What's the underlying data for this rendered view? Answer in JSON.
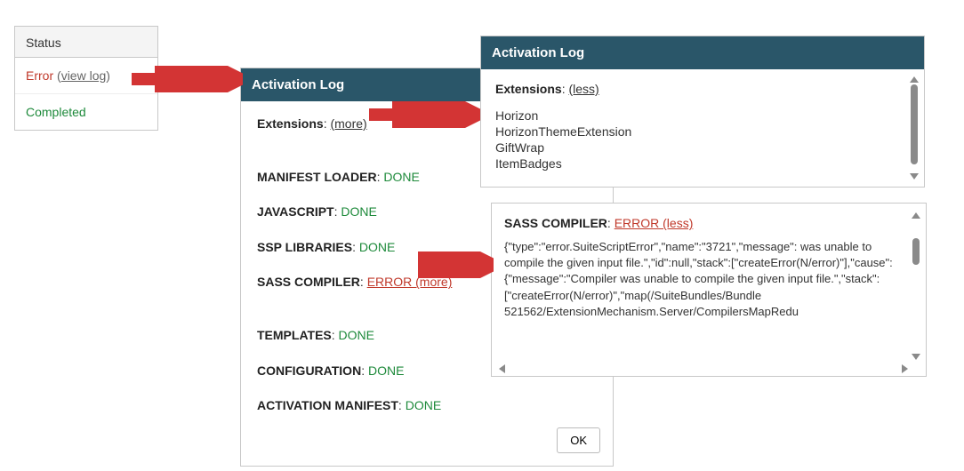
{
  "status": {
    "header": "Status",
    "error_label": "Error",
    "view_log_open": "(",
    "view_log": "view log",
    "view_log_close": ")",
    "completed_label": "Completed"
  },
  "dialog": {
    "title": "Activation Log",
    "ext_label": "Extensions",
    "more": "(more)",
    "steps": [
      {
        "label": "MANIFEST LOADER",
        "status": "DONE",
        "cls": "done"
      },
      {
        "label": "JAVASCRIPT",
        "status": "DONE",
        "cls": "done"
      },
      {
        "label": "SSP LIBRARIES",
        "status": "DONE",
        "cls": "done"
      },
      {
        "label": "SASS COMPILER",
        "status": "ERROR (more)",
        "cls": "err"
      },
      {
        "label": "TEMPLATES",
        "status": "DONE",
        "cls": "done"
      },
      {
        "label": "CONFIGURATION",
        "status": "DONE",
        "cls": "done"
      },
      {
        "label": "ACTIVATION MANIFEST",
        "status": "DONE",
        "cls": "done"
      }
    ],
    "ok": "OK"
  },
  "ext_panel": {
    "title": "Activation Log",
    "ext_label": "Extensions",
    "less": "(less)",
    "items": [
      "Horizon",
      "HorizonThemeExtension",
      "GiftWrap",
      "ItemBadges"
    ]
  },
  "err_panel": {
    "label": "SASS COMPILER",
    "status": "ERROR (less)",
    "body": "{\"type\":\"error.SuiteScriptError\",\"name\":\"3721\",\"message\": was unable to compile the given input file.\",\"id\":null,\"stack\":[\"createError(N/error)\"],\"cause\":{\"message\":\"Compiler was unable to compile the given input file.\",\"stack\":[\"createError(N/error)\",\"map(/SuiteBundles/Bundle 521562/ExtensionMechanism.Server/CompilersMapRedu"
  }
}
